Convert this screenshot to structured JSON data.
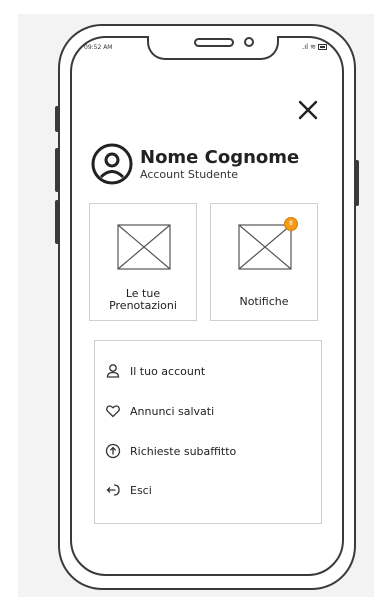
{
  "status_bar": {
    "time": "09:52 AM"
  },
  "profile": {
    "name": "Nome Cognome",
    "role": "Account Studente"
  },
  "cards": [
    {
      "label_line1": "Le tue",
      "label_line2": "Prenotazioni"
    },
    {
      "label": "Notifiche",
      "badge": "8"
    }
  ],
  "menu": [
    {
      "label": "Il tuo account",
      "icon": "user-icon"
    },
    {
      "label": "Annunci salvati",
      "icon": "heart-icon"
    },
    {
      "label": "Richieste subaffitto",
      "icon": "arrow-up-circle-icon"
    },
    {
      "label": "Esci",
      "icon": "logout-icon"
    }
  ],
  "colors": {
    "badge": "#f29a1a",
    "border": "#cfcfcf",
    "outline": "#3a3a3a"
  }
}
